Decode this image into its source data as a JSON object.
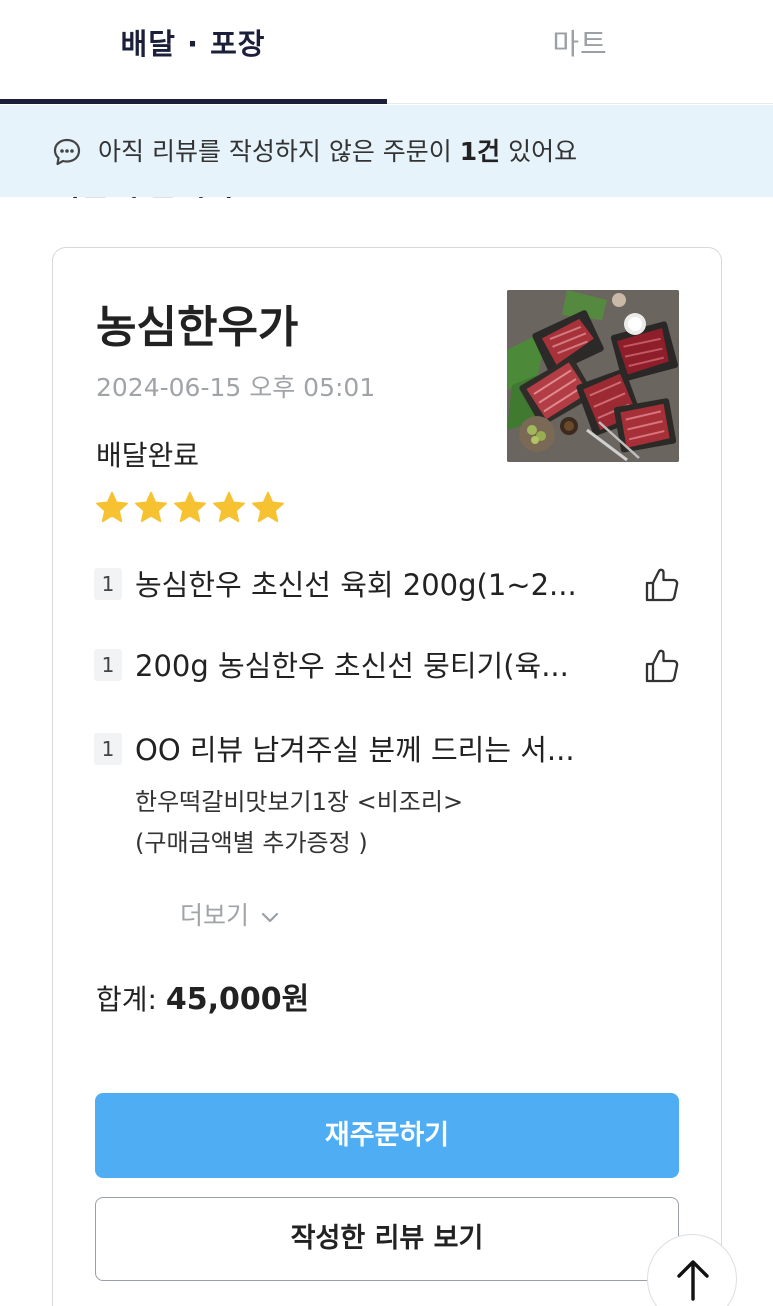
{
  "tabs": [
    {
      "label": "배달 · 포장",
      "active": true
    },
    {
      "label": "마트",
      "active": false
    }
  ],
  "banner": {
    "icon": "chat-bubble-icon",
    "text_before": "아직 리뷰를 작성하지 않은 주문이 ",
    "count": "1건",
    "text_after": " 있어요"
  },
  "section_heading": "최근 주문내역",
  "order": {
    "store_name": "농심한우가",
    "date": "2024-06-15 오후 05:01",
    "status": "배달완료",
    "rating": 5,
    "thumbnail": "meat-platter-photo",
    "items": [
      {
        "qty": "1",
        "name": "농심한우 초신선 육회 200g(1~2...",
        "liked": false
      },
      {
        "qty": "1",
        "name": "200g 농심한우 초신선 뭉티기(육...",
        "liked": false
      },
      {
        "qty": "1",
        "name": "OO 리뷰 남겨주실 분께 드리는 서...",
        "options": [
          "한우떡갈비맛보기1장 <비조리>",
          "(구매금액별 추가증정 )"
        ]
      }
    ],
    "more_label": "더보기",
    "total_label": "합계: ",
    "total_value": "45,000원",
    "reorder_label": "재주문하기",
    "review_label": "작성한 리뷰 보기"
  },
  "colors": {
    "accent_blue": "#4fadf4",
    "banner_bg": "#e6f3fb",
    "star": "#f7c232",
    "tab_active": "#1b1f3a"
  }
}
